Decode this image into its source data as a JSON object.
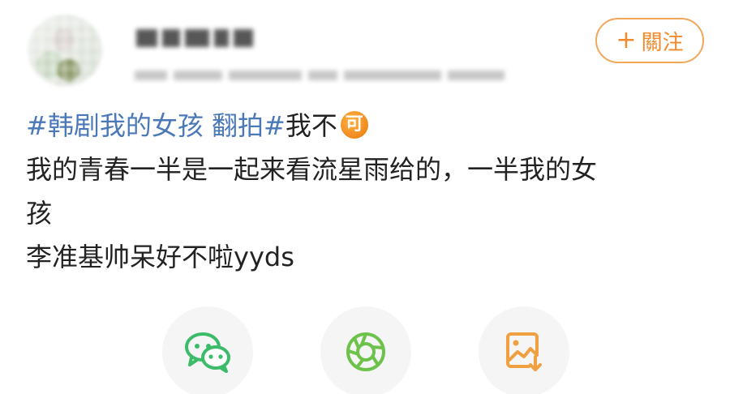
{
  "header": {
    "follow_label": "關注",
    "follow_plus": "+"
  },
  "post": {
    "topic": "#韩剧我的女孩 翻拍#",
    "line1_rest": "我不",
    "emoji_text": "可",
    "line2": "我的青春一半是一起来看流星雨给的，一半我的女",
    "line3": "孩",
    "line4": "李准基帅呆好不啦yyds"
  },
  "share": {
    "items": [
      {
        "icon": "wechat-icon"
      },
      {
        "icon": "moments-icon"
      },
      {
        "icon": "save-image-icon"
      }
    ]
  },
  "colors": {
    "accent": "#f08a2c",
    "topic": "#4a78b8",
    "wechat": "#3cbb6b",
    "moments": "#6cc24a",
    "save": "#f0a040"
  }
}
